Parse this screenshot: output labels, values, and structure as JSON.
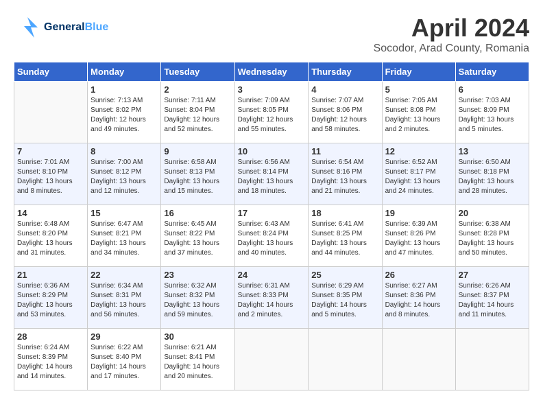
{
  "header": {
    "logo_general": "General",
    "logo_blue": "Blue",
    "month_title": "April 2024",
    "subtitle": "Socodor, Arad County, Romania"
  },
  "weekdays": [
    "Sunday",
    "Monday",
    "Tuesday",
    "Wednesday",
    "Thursday",
    "Friday",
    "Saturday"
  ],
  "weeks": [
    [
      {
        "day": "",
        "sunrise": "",
        "sunset": "",
        "daylight": ""
      },
      {
        "day": "1",
        "sunrise": "Sunrise: 7:13 AM",
        "sunset": "Sunset: 8:02 PM",
        "daylight": "Daylight: 12 hours and 49 minutes."
      },
      {
        "day": "2",
        "sunrise": "Sunrise: 7:11 AM",
        "sunset": "Sunset: 8:04 PM",
        "daylight": "Daylight: 12 hours and 52 minutes."
      },
      {
        "day": "3",
        "sunrise": "Sunrise: 7:09 AM",
        "sunset": "Sunset: 8:05 PM",
        "daylight": "Daylight: 12 hours and 55 minutes."
      },
      {
        "day": "4",
        "sunrise": "Sunrise: 7:07 AM",
        "sunset": "Sunset: 8:06 PM",
        "daylight": "Daylight: 12 hours and 58 minutes."
      },
      {
        "day": "5",
        "sunrise": "Sunrise: 7:05 AM",
        "sunset": "Sunset: 8:08 PM",
        "daylight": "Daylight: 13 hours and 2 minutes."
      },
      {
        "day": "6",
        "sunrise": "Sunrise: 7:03 AM",
        "sunset": "Sunset: 8:09 PM",
        "daylight": "Daylight: 13 hours and 5 minutes."
      }
    ],
    [
      {
        "day": "7",
        "sunrise": "Sunrise: 7:01 AM",
        "sunset": "Sunset: 8:10 PM",
        "daylight": "Daylight: 13 hours and 8 minutes."
      },
      {
        "day": "8",
        "sunrise": "Sunrise: 7:00 AM",
        "sunset": "Sunset: 8:12 PM",
        "daylight": "Daylight: 13 hours and 12 minutes."
      },
      {
        "day": "9",
        "sunrise": "Sunrise: 6:58 AM",
        "sunset": "Sunset: 8:13 PM",
        "daylight": "Daylight: 13 hours and 15 minutes."
      },
      {
        "day": "10",
        "sunrise": "Sunrise: 6:56 AM",
        "sunset": "Sunset: 8:14 PM",
        "daylight": "Daylight: 13 hours and 18 minutes."
      },
      {
        "day": "11",
        "sunrise": "Sunrise: 6:54 AM",
        "sunset": "Sunset: 8:16 PM",
        "daylight": "Daylight: 13 hours and 21 minutes."
      },
      {
        "day": "12",
        "sunrise": "Sunrise: 6:52 AM",
        "sunset": "Sunset: 8:17 PM",
        "daylight": "Daylight: 13 hours and 24 minutes."
      },
      {
        "day": "13",
        "sunrise": "Sunrise: 6:50 AM",
        "sunset": "Sunset: 8:18 PM",
        "daylight": "Daylight: 13 hours and 28 minutes."
      }
    ],
    [
      {
        "day": "14",
        "sunrise": "Sunrise: 6:48 AM",
        "sunset": "Sunset: 8:20 PM",
        "daylight": "Daylight: 13 hours and 31 minutes."
      },
      {
        "day": "15",
        "sunrise": "Sunrise: 6:47 AM",
        "sunset": "Sunset: 8:21 PM",
        "daylight": "Daylight: 13 hours and 34 minutes."
      },
      {
        "day": "16",
        "sunrise": "Sunrise: 6:45 AM",
        "sunset": "Sunset: 8:22 PM",
        "daylight": "Daylight: 13 hours and 37 minutes."
      },
      {
        "day": "17",
        "sunrise": "Sunrise: 6:43 AM",
        "sunset": "Sunset: 8:24 PM",
        "daylight": "Daylight: 13 hours and 40 minutes."
      },
      {
        "day": "18",
        "sunrise": "Sunrise: 6:41 AM",
        "sunset": "Sunset: 8:25 PM",
        "daylight": "Daylight: 13 hours and 44 minutes."
      },
      {
        "day": "19",
        "sunrise": "Sunrise: 6:39 AM",
        "sunset": "Sunset: 8:26 PM",
        "daylight": "Daylight: 13 hours and 47 minutes."
      },
      {
        "day": "20",
        "sunrise": "Sunrise: 6:38 AM",
        "sunset": "Sunset: 8:28 PM",
        "daylight": "Daylight: 13 hours and 50 minutes."
      }
    ],
    [
      {
        "day": "21",
        "sunrise": "Sunrise: 6:36 AM",
        "sunset": "Sunset: 8:29 PM",
        "daylight": "Daylight: 13 hours and 53 minutes."
      },
      {
        "day": "22",
        "sunrise": "Sunrise: 6:34 AM",
        "sunset": "Sunset: 8:31 PM",
        "daylight": "Daylight: 13 hours and 56 minutes."
      },
      {
        "day": "23",
        "sunrise": "Sunrise: 6:32 AM",
        "sunset": "Sunset: 8:32 PM",
        "daylight": "Daylight: 13 hours and 59 minutes."
      },
      {
        "day": "24",
        "sunrise": "Sunrise: 6:31 AM",
        "sunset": "Sunset: 8:33 PM",
        "daylight": "Daylight: 14 hours and 2 minutes."
      },
      {
        "day": "25",
        "sunrise": "Sunrise: 6:29 AM",
        "sunset": "Sunset: 8:35 PM",
        "daylight": "Daylight: 14 hours and 5 minutes."
      },
      {
        "day": "26",
        "sunrise": "Sunrise: 6:27 AM",
        "sunset": "Sunset: 8:36 PM",
        "daylight": "Daylight: 14 hours and 8 minutes."
      },
      {
        "day": "27",
        "sunrise": "Sunrise: 6:26 AM",
        "sunset": "Sunset: 8:37 PM",
        "daylight": "Daylight: 14 hours and 11 minutes."
      }
    ],
    [
      {
        "day": "28",
        "sunrise": "Sunrise: 6:24 AM",
        "sunset": "Sunset: 8:39 PM",
        "daylight": "Daylight: 14 hours and 14 minutes."
      },
      {
        "day": "29",
        "sunrise": "Sunrise: 6:22 AM",
        "sunset": "Sunset: 8:40 PM",
        "daylight": "Daylight: 14 hours and 17 minutes."
      },
      {
        "day": "30",
        "sunrise": "Sunrise: 6:21 AM",
        "sunset": "Sunset: 8:41 PM",
        "daylight": "Daylight: 14 hours and 20 minutes."
      },
      {
        "day": "",
        "sunrise": "",
        "sunset": "",
        "daylight": ""
      },
      {
        "day": "",
        "sunrise": "",
        "sunset": "",
        "daylight": ""
      },
      {
        "day": "",
        "sunrise": "",
        "sunset": "",
        "daylight": ""
      },
      {
        "day": "",
        "sunrise": "",
        "sunset": "",
        "daylight": ""
      }
    ]
  ]
}
